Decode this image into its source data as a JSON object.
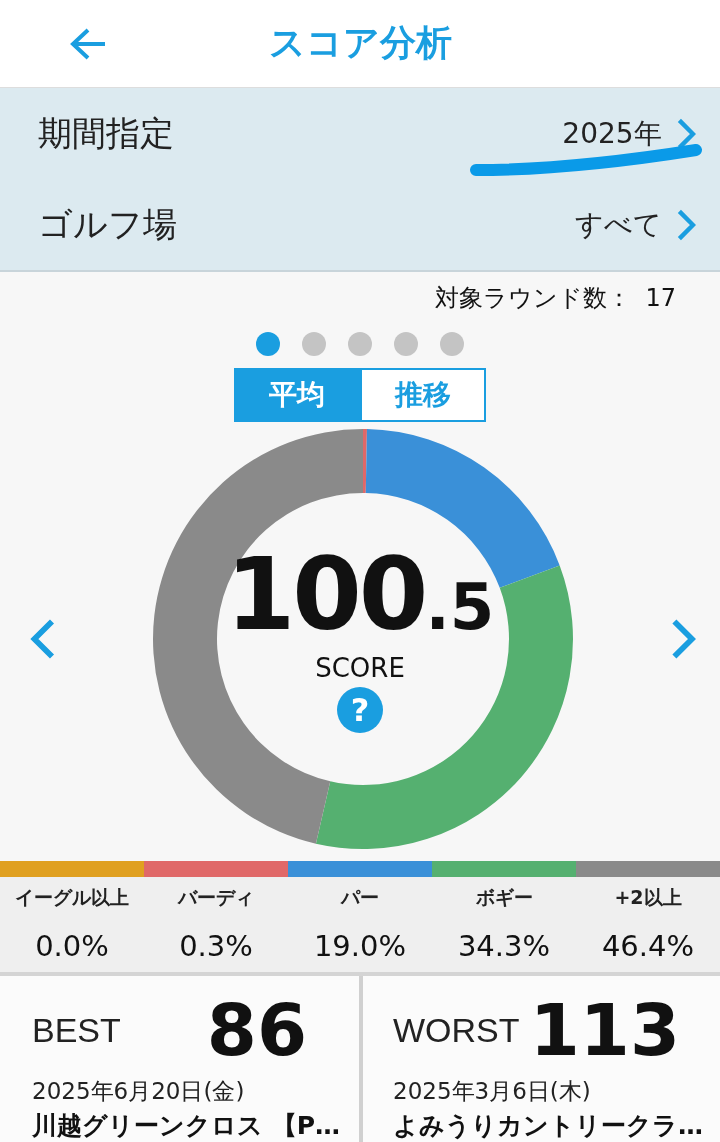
{
  "header": {
    "title": "スコア分析"
  },
  "filters": [
    {
      "label": "期間指定",
      "value": "2025年",
      "annotated": true
    },
    {
      "label": "ゴルフ場",
      "value": "すべて",
      "annotated": false
    }
  ],
  "round_count": {
    "label": "対象ラウンド数：",
    "value": "17"
  },
  "pager": [
    {
      "selected": true
    },
    {
      "selected": false
    },
    {
      "selected": false
    },
    {
      "selected": false
    },
    {
      "selected": false
    }
  ],
  "tabs": [
    {
      "label": "平均",
      "selected": true
    },
    {
      "label": "推移",
      "selected": false
    }
  ],
  "donut": {
    "score_whole": "100",
    "score_fraction": ".5",
    "caption": "SCORE",
    "help": "?",
    "chart_data": {
      "type": "donut",
      "values": [
        0.0,
        0.3,
        19.0,
        34.3,
        46.4
      ]
    }
  },
  "stats": [
    {
      "label": "イーグル以上",
      "value": "0.0%",
      "color": "#e0a020"
    },
    {
      "label": "バーディ",
      "value": "0.3%",
      "color": "#e06868"
    },
    {
      "label": "パー",
      "value": "19.0%",
      "color": "#3a90d8"
    },
    {
      "label": "ボギー",
      "value": "34.3%",
      "color": "#55b070"
    },
    {
      "label": "+2以上",
      "value": "46.4%",
      "color": "#8a8a8a"
    }
  ],
  "records": [
    {
      "label": "BEST",
      "score": "86",
      "date": "2025年6月20日(金)",
      "course": "川越グリーンクロス 【P…"
    },
    {
      "label": "WORST",
      "score": "113",
      "date": "2025年3月6日(木)",
      "course": "よみうりカントリークラ…"
    }
  ]
}
